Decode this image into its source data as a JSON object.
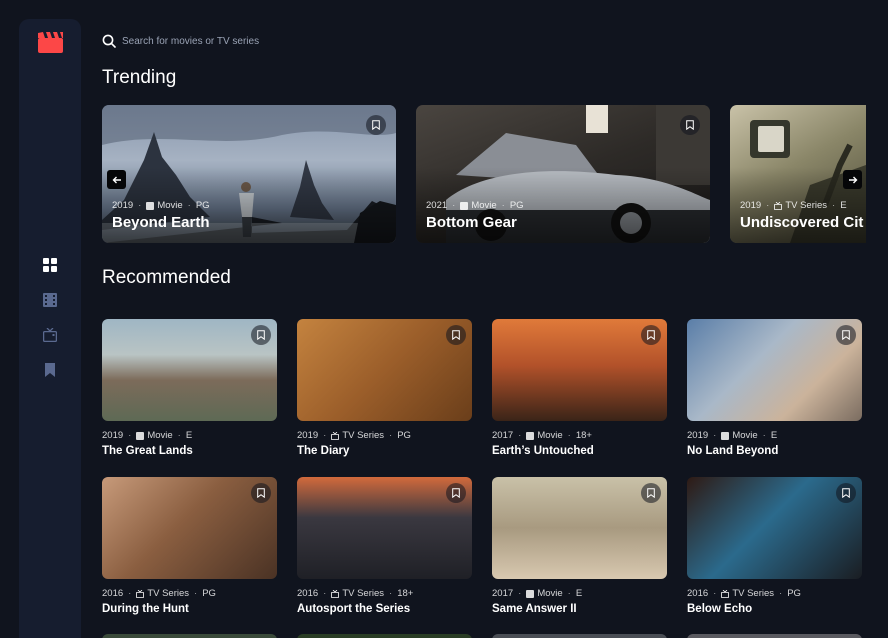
{
  "search": {
    "placeholder": "Search for movies or TV series"
  },
  "sections": {
    "trending": "Trending",
    "recommended": "Recommended"
  },
  "nav": [
    "home-icon",
    "movies-icon",
    "tv-series-icon",
    "bookmarks-icon"
  ],
  "trending": [
    {
      "year": "2019",
      "category": "Movie",
      "rating": "PG",
      "title": "Beyond Earth"
    },
    {
      "year": "2021",
      "category": "Movie",
      "rating": "PG",
      "title": "Bottom Gear"
    },
    {
      "year": "2019",
      "category": "TV Series",
      "rating": "E",
      "title": "Undiscovered Cit"
    }
  ],
  "recommended": [
    {
      "year": "2019",
      "category": "Movie",
      "rating": "E",
      "title": "The Great Lands"
    },
    {
      "year": "2019",
      "category": "TV Series",
      "rating": "PG",
      "title": "The Diary"
    },
    {
      "year": "2017",
      "category": "Movie",
      "rating": "18+",
      "title": "Earth’s Untouched"
    },
    {
      "year": "2019",
      "category": "Movie",
      "rating": "E",
      "title": "No Land Beyond"
    },
    {
      "year": "2016",
      "category": "TV Series",
      "rating": "PG",
      "title": "During the Hunt"
    },
    {
      "year": "2016",
      "category": "TV Series",
      "rating": "18+",
      "title": "Autosport the Series"
    },
    {
      "year": "2017",
      "category": "Movie",
      "rating": "E",
      "title": "Same Answer II"
    },
    {
      "year": "2016",
      "category": "TV Series",
      "rating": "PG",
      "title": "Below Echo"
    }
  ],
  "colors": {
    "background": "#10141e",
    "sidebar": "#161d2f",
    "accent": "#fc4747",
    "muted": "#5a698f"
  }
}
